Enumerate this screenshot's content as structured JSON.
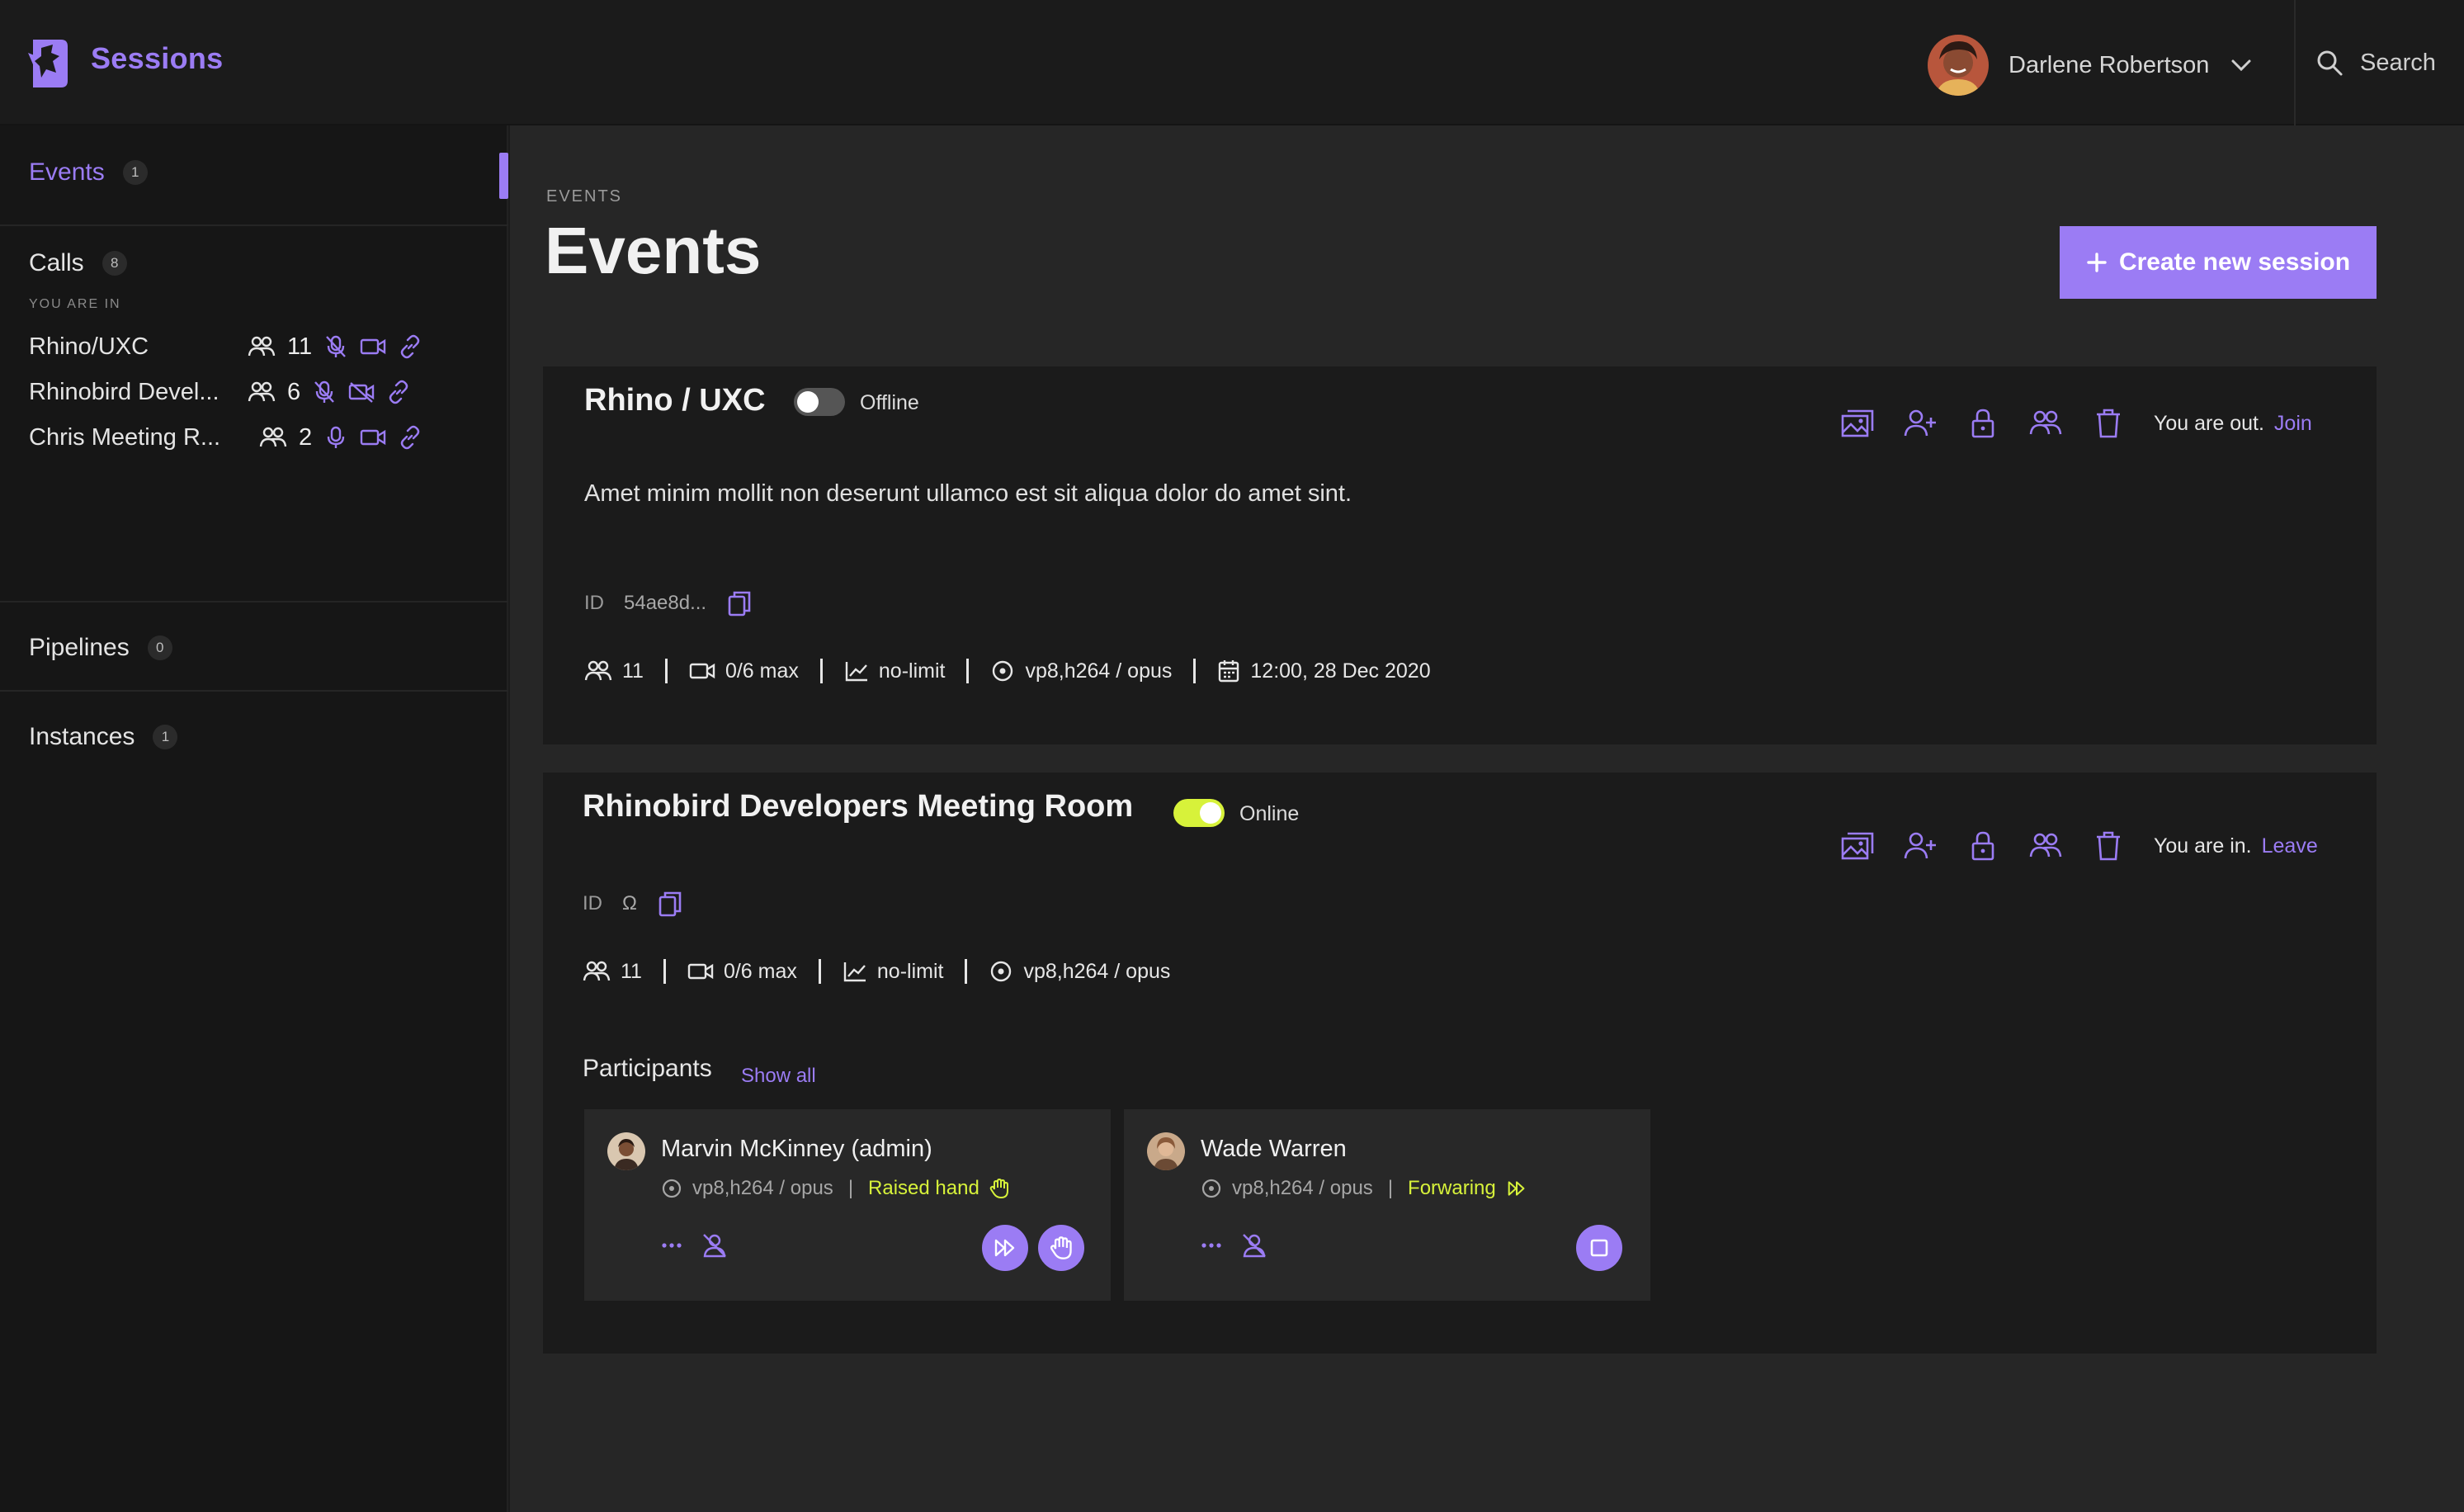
{
  "app": {
    "name": "Sessions"
  },
  "header": {
    "user_name": "Darlene Robertson",
    "search_label": "Search"
  },
  "sidebar": {
    "events": {
      "label": "Events",
      "count": "1"
    },
    "calls": {
      "label": "Calls",
      "count": "8",
      "subheading": "YOU ARE IN",
      "items": [
        {
          "name": "Rhino/UXC",
          "participants": "11"
        },
        {
          "name": "Rhinobird Devel...",
          "participants": "6"
        },
        {
          "name": "Chris Meeting R...",
          "participants": "2"
        }
      ]
    },
    "pipelines": {
      "label": "Pipelines",
      "count": "0"
    },
    "instances": {
      "label": "Instances",
      "count": "1"
    }
  },
  "main": {
    "breadcrumb": "EVENTS",
    "title": "Events",
    "create_button": "Create new session"
  },
  "sessions": [
    {
      "title": "Rhino / UXC",
      "status": "Offline",
      "online": false,
      "description": "Amet minim mollit non deserunt ullamco est sit aliqua dolor do amet sint.",
      "id_label": "ID",
      "id_value": "54ae8d...",
      "participants": "11",
      "video": "0/6 max",
      "bitrate": "no-limit",
      "codecs": "vp8,h264 / opus",
      "date": "12:00, 28 Dec 2020",
      "presence": "You are out.",
      "presence_action": "Join"
    },
    {
      "title": "Rhinobird Developers Meeting Room",
      "status": "Online",
      "online": true,
      "id_label": "ID",
      "id_value": "Ω",
      "participants": "11",
      "video": "0/6 max",
      "bitrate": "no-limit",
      "codecs": "vp8,h264 / opus",
      "presence": "You are in.",
      "presence_action": "Leave",
      "participants_label": "Participants",
      "show_all": "Show all",
      "participant_list": [
        {
          "name": "Marvin McKinney (admin)",
          "codecs": "vp8,h264 / opus",
          "status": "Raised hand"
        },
        {
          "name": "Wade Warren",
          "codecs": "vp8,h264 / opus",
          "status": "Forwaring"
        }
      ]
    }
  ],
  "colors": {
    "accent": "#9b7cf4",
    "online": "#d7f23a",
    "background": "#1b1b1b",
    "panel": "#262626"
  }
}
